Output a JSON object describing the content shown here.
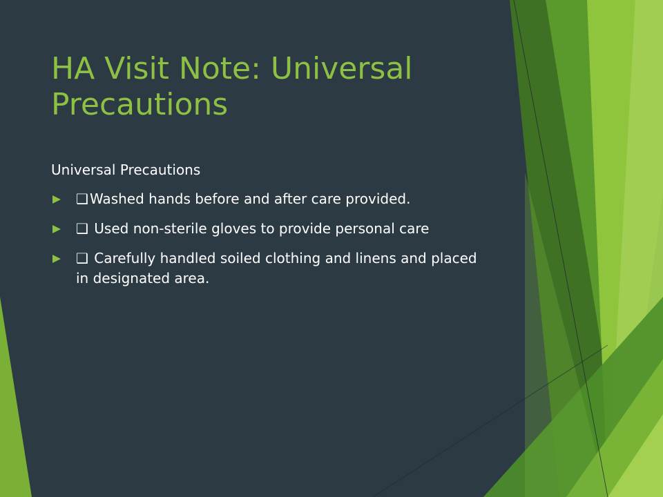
{
  "slide": {
    "title": "HA Visit Note: Universal Precautions",
    "subheading": "Universal Precautions",
    "items": [
      {
        "checkbox": "❑",
        "text": "Washed hands before and after care provided."
      },
      {
        "checkbox": "❑",
        "text": " Used non-sterile gloves to provide personal care"
      },
      {
        "checkbox": "❑",
        "text": " Carefully handled soiled clothing and linens and placed in designated area."
      }
    ]
  },
  "colors": {
    "background": "#2c3a44",
    "accent": "#8dc043",
    "text": "#ffffff"
  },
  "icons": {
    "bullet": "triangle-right-icon",
    "checkbox": "checkbox-icon"
  }
}
